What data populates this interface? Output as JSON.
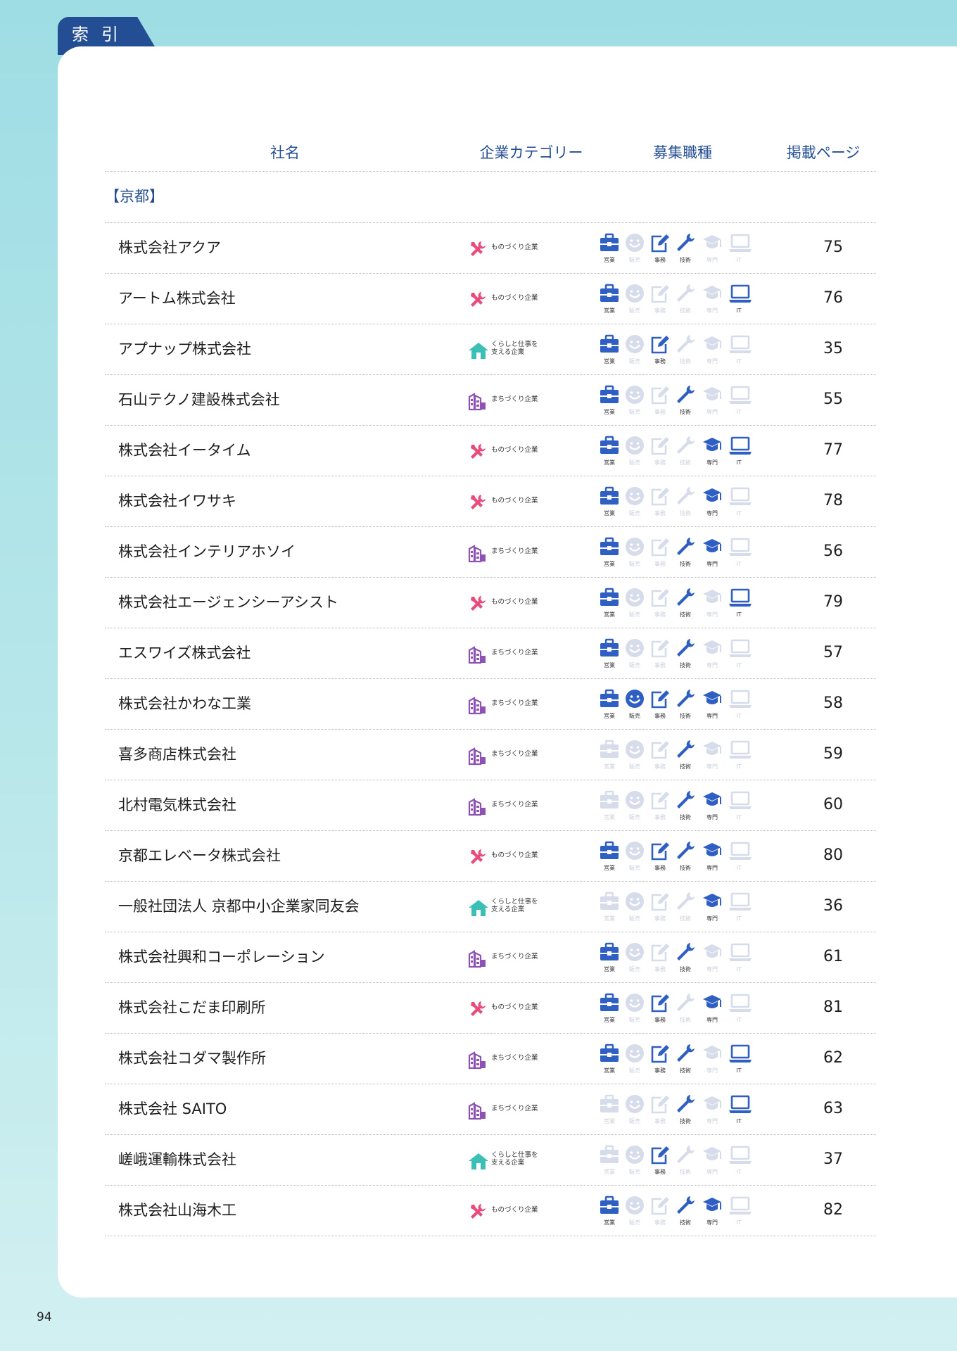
{
  "tab_label": "索引",
  "page_number": "94",
  "headers": {
    "name": "社名",
    "category": "企業カテゴリー",
    "jobs": "募集職種",
    "page": "掲載ページ"
  },
  "region": "【京都】",
  "colors": {
    "navy": "#244e94",
    "job_blue": "#2f5fc2",
    "job_off": "#d6dcea",
    "mono": "#e94b7b",
    "machi": "#8d52b3",
    "kurashi": "#3cbfb4"
  },
  "category_labels": {
    "mono": [
      "ものづくり企業"
    ],
    "machi": [
      "まちづくり企業"
    ],
    "kurashi": [
      "くらしと仕事を",
      "支える企業"
    ]
  },
  "job_labels": [
    "営業",
    "販売",
    "事務",
    "技術",
    "専門",
    "IT"
  ],
  "job_icons": [
    "briefcase-icon",
    "smiley-icon",
    "pen-notepad-icon",
    "wrench-icon",
    "graduation-cap-icon",
    "laptop-icon"
  ],
  "companies": [
    {
      "name": "株式会社アクア",
      "category": "mono",
      "jobs": [
        1,
        0,
        1,
        1,
        0,
        0
      ],
      "page": "75"
    },
    {
      "name": "アートム株式会社",
      "category": "mono",
      "jobs": [
        1,
        0,
        0,
        0,
        0,
        1
      ],
      "page": "76"
    },
    {
      "name": "アプナップ株式会社",
      "category": "kurashi",
      "jobs": [
        1,
        0,
        1,
        0,
        0,
        0
      ],
      "page": "35"
    },
    {
      "name": "石山テクノ建設株式会社",
      "category": "machi",
      "jobs": [
        1,
        0,
        0,
        1,
        0,
        0
      ],
      "page": "55"
    },
    {
      "name": "株式会社イータイム",
      "category": "mono",
      "jobs": [
        1,
        0,
        0,
        0,
        1,
        1
      ],
      "page": "77"
    },
    {
      "name": "株式会社イワサキ",
      "category": "mono",
      "jobs": [
        1,
        0,
        0,
        0,
        1,
        0
      ],
      "page": "78"
    },
    {
      "name": "株式会社インテリアホソイ",
      "category": "machi",
      "jobs": [
        1,
        0,
        0,
        1,
        1,
        0
      ],
      "page": "56"
    },
    {
      "name": "株式会社エージェンシーアシスト",
      "category": "mono",
      "jobs": [
        1,
        0,
        0,
        1,
        0,
        1
      ],
      "page": "79"
    },
    {
      "name": "エスワイズ株式会社",
      "category": "machi",
      "jobs": [
        1,
        0,
        0,
        1,
        0,
        0
      ],
      "page": "57"
    },
    {
      "name": "株式会社かわな工業",
      "category": "machi",
      "jobs": [
        1,
        1,
        1,
        1,
        1,
        0
      ],
      "page": "58"
    },
    {
      "name": "喜多商店株式会社",
      "category": "machi",
      "jobs": [
        0,
        0,
        0,
        1,
        0,
        0
      ],
      "page": "59"
    },
    {
      "name": "北村電気株式会社",
      "category": "machi",
      "jobs": [
        0,
        0,
        0,
        1,
        1,
        0
      ],
      "page": "60"
    },
    {
      "name": "京都エレベータ株式会社",
      "category": "mono",
      "jobs": [
        1,
        0,
        1,
        1,
        1,
        0
      ],
      "page": "80"
    },
    {
      "name": "一般社団法人 京都中小企業家同友会",
      "category": "kurashi",
      "jobs": [
        0,
        0,
        0,
        0,
        1,
        0
      ],
      "page": "36"
    },
    {
      "name": "株式会社興和コーポレーション",
      "category": "machi",
      "jobs": [
        1,
        0,
        0,
        1,
        0,
        0
      ],
      "page": "61"
    },
    {
      "name": "株式会社こだま印刷所",
      "category": "mono",
      "jobs": [
        1,
        0,
        1,
        0,
        1,
        0
      ],
      "page": "81"
    },
    {
      "name": "株式会社コダマ製作所",
      "category": "machi",
      "jobs": [
        1,
        0,
        1,
        1,
        0,
        1
      ],
      "page": "62"
    },
    {
      "name": "株式会社 SAITO",
      "category": "machi",
      "jobs": [
        0,
        0,
        0,
        1,
        0,
        1
      ],
      "page": "63"
    },
    {
      "name": "嵯峨運輸株式会社",
      "category": "kurashi",
      "jobs": [
        0,
        0,
        1,
        0,
        0,
        0
      ],
      "page": "37"
    },
    {
      "name": "株式会社山海木工",
      "category": "mono",
      "jobs": [
        1,
        0,
        0,
        1,
        1,
        0
      ],
      "page": "82"
    }
  ]
}
